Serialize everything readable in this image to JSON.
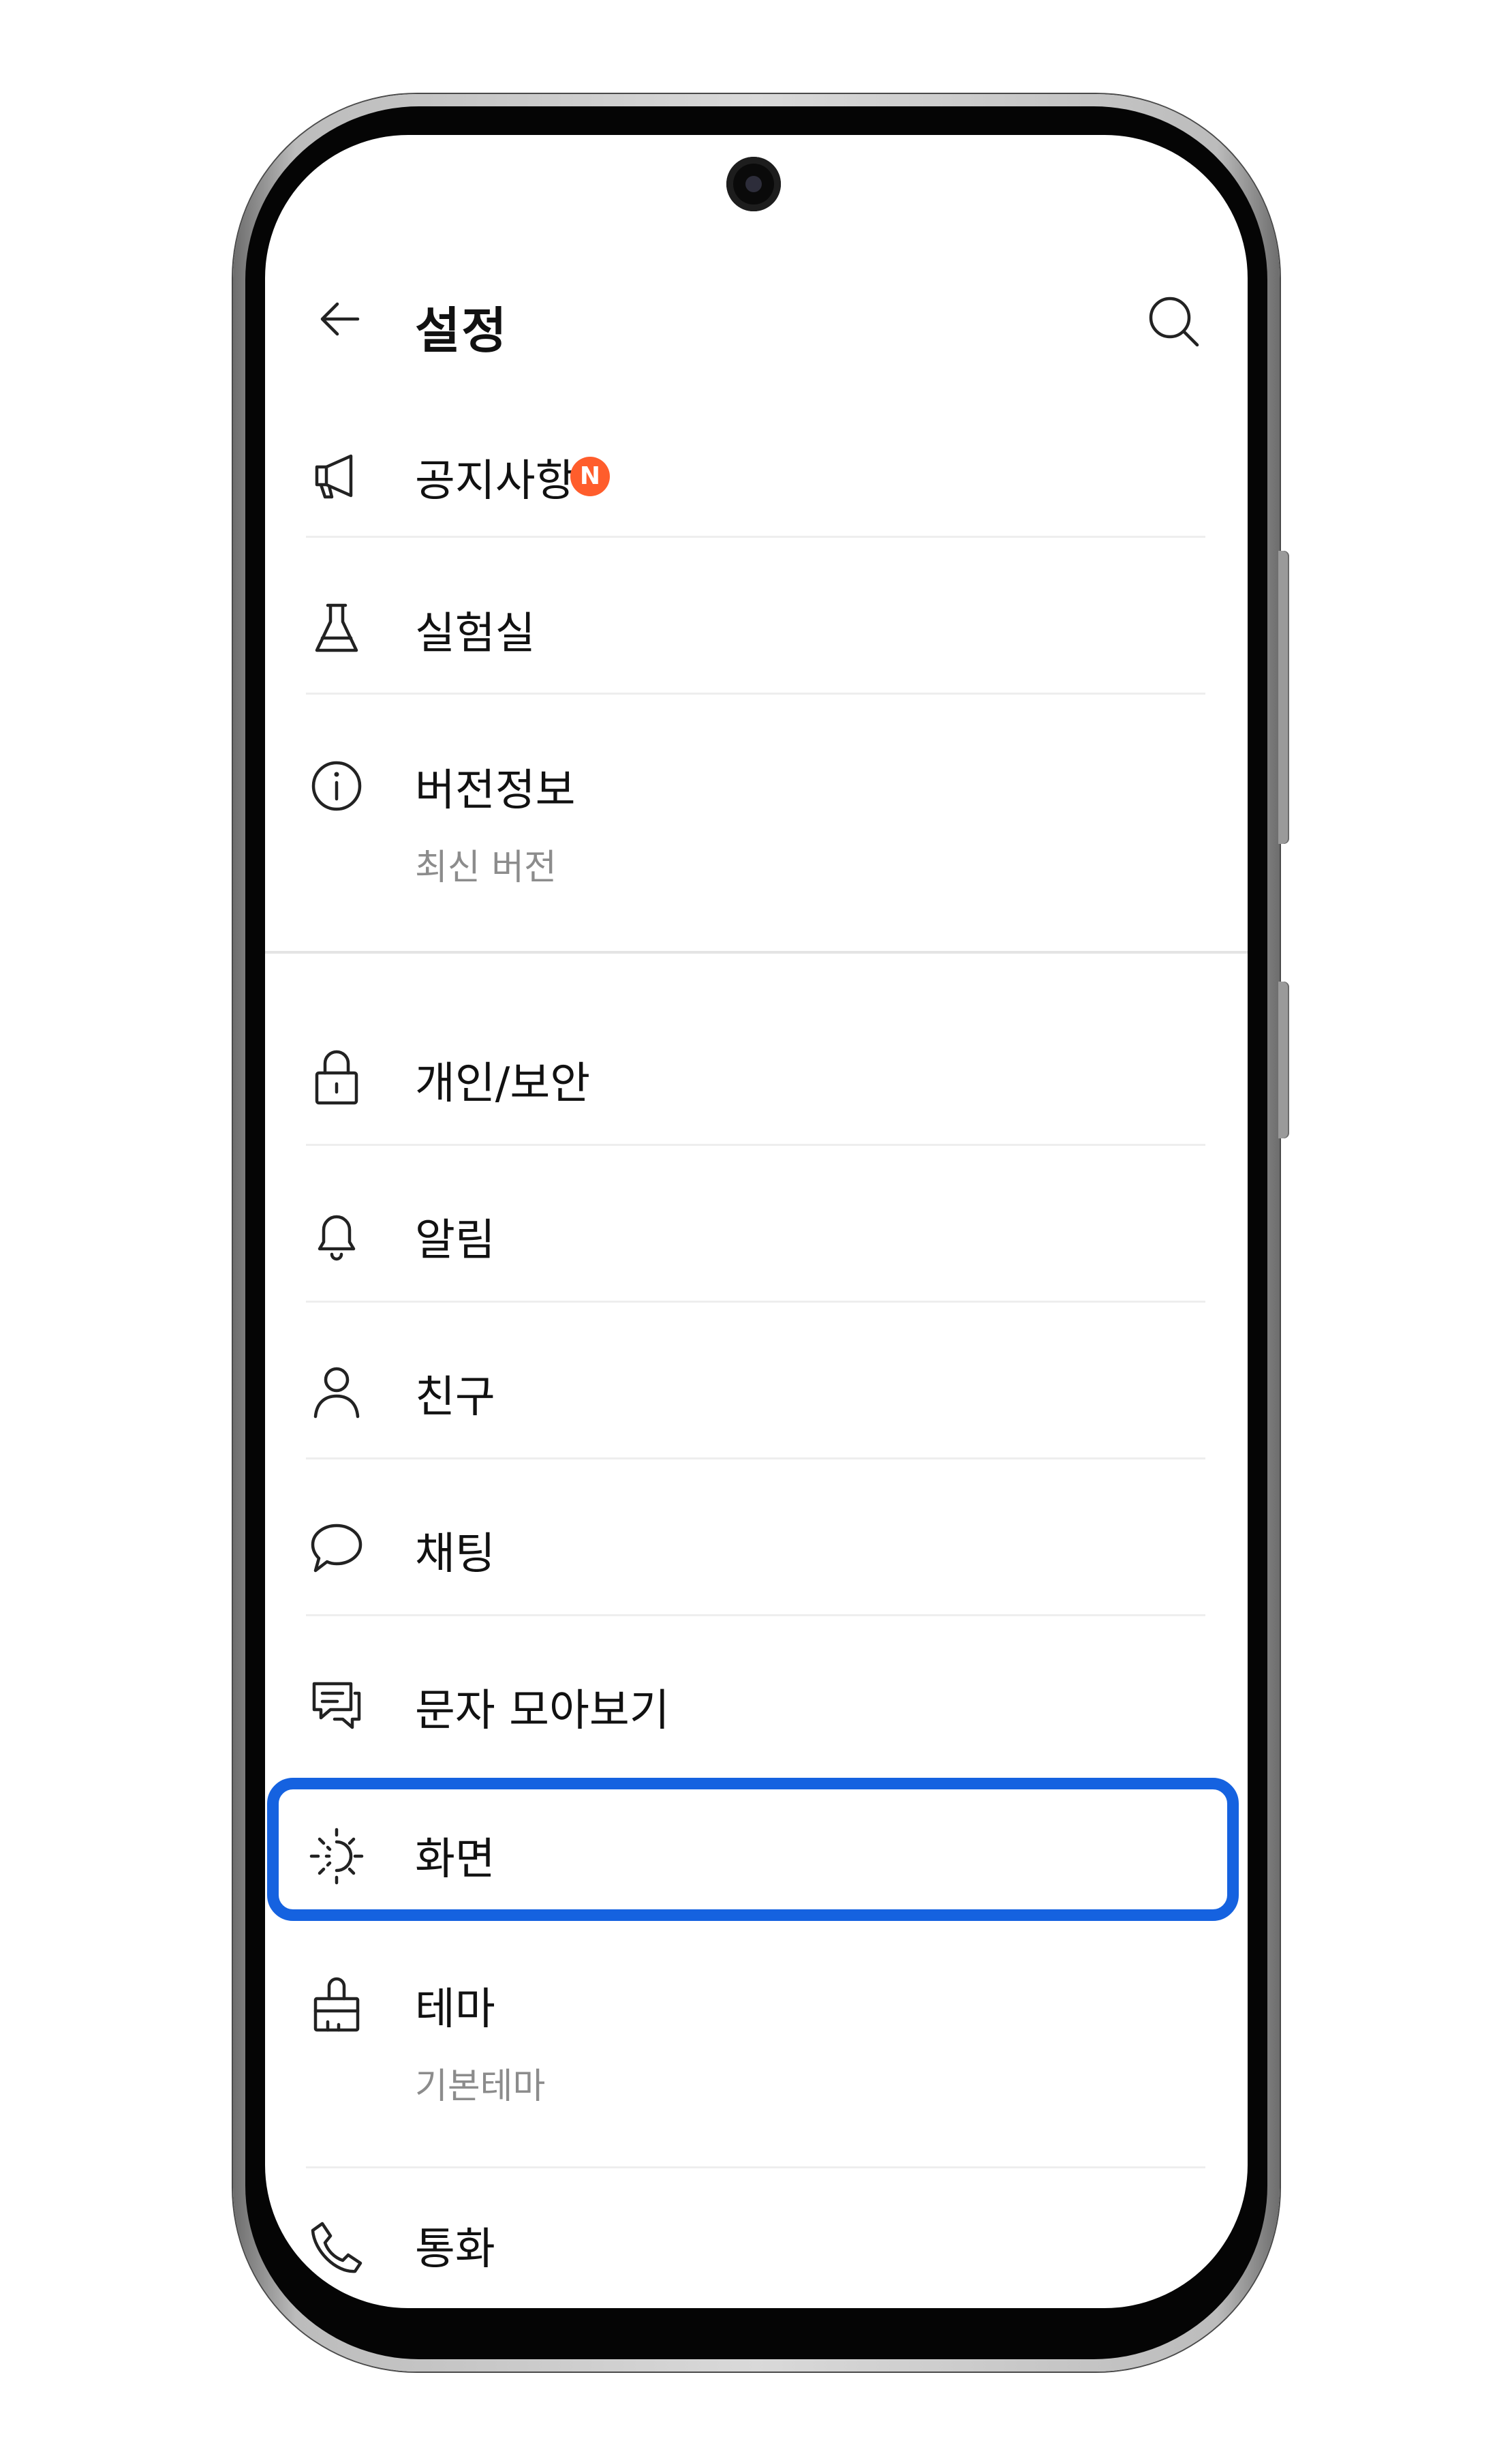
{
  "header": {
    "title": "설정",
    "back_icon": "arrow-left-icon",
    "search_icon": "search-icon"
  },
  "menu": {
    "notice": {
      "label": "공지사항",
      "badge": "N",
      "icon": "megaphone-icon"
    },
    "lab": {
      "label": "실험실",
      "icon": "flask-icon"
    },
    "version": {
      "label": "버전정보",
      "sub": "최신 버전",
      "icon": "info-icon"
    },
    "privacy": {
      "label": "개인/보안",
      "icon": "lock-icon"
    },
    "alarm": {
      "label": "알림",
      "icon": "bell-icon"
    },
    "friends": {
      "label": "친구",
      "icon": "person-icon"
    },
    "chat": {
      "label": "채팅",
      "icon": "chat-bubble-icon"
    },
    "sms": {
      "label": "문자 모아보기",
      "icon": "message-collection-icon"
    },
    "display": {
      "label": "화면",
      "icon": "brightness-icon",
      "highlighted": true
    },
    "theme": {
      "label": "테마",
      "sub": "기본테마",
      "icon": "paint-brush-icon"
    },
    "call": {
      "label": "통화",
      "icon": "phone-icon"
    }
  },
  "colors": {
    "highlight": "#1562e0",
    "badge": "#ff5d2c",
    "subtext": "#8c8c8c"
  }
}
